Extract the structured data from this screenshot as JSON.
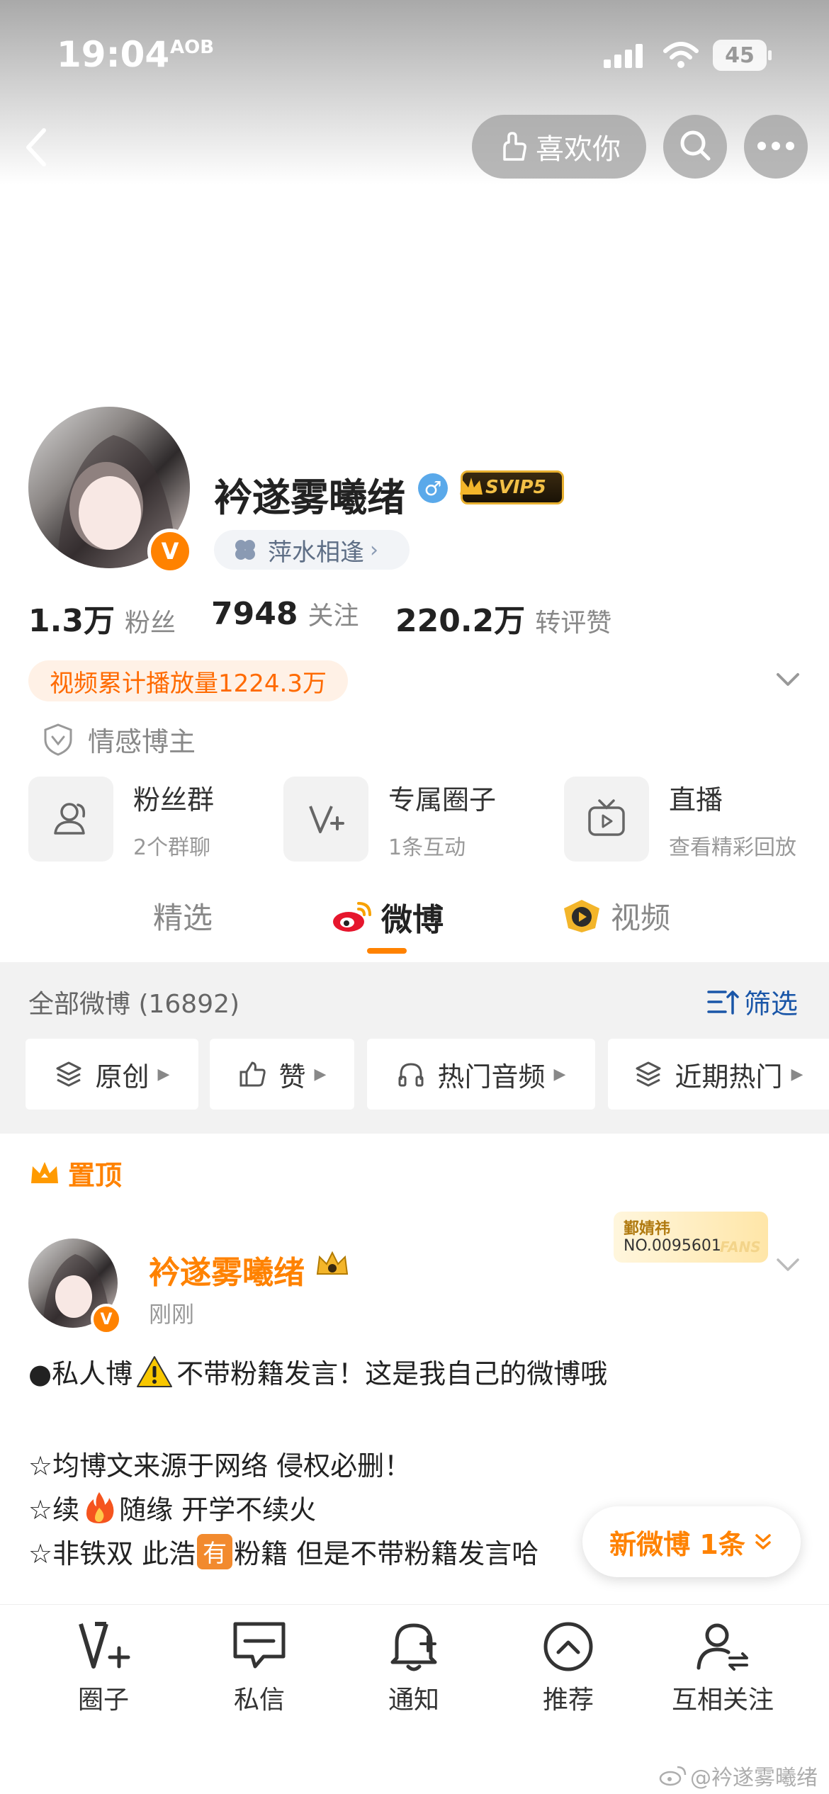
{
  "status_bar": {
    "time": "19:04",
    "app_mark": "AOB",
    "battery": "45"
  },
  "topbar": {
    "like_label": "喜欢你"
  },
  "profile": {
    "username": "衿遂雾曦绪",
    "gender_icon": "♂",
    "vip_badge": "SVIP5",
    "verified_mark": "V",
    "group_tag": "萍水相逢",
    "followers_value": "1.3万",
    "followers_label": "粉丝",
    "following_value": "7948",
    "following_label": "关注",
    "likes_value": "220.2万",
    "likes_label": "转评赞",
    "video_stat": "视频累计播放量1224.3万",
    "category": "情感博主"
  },
  "features": [
    {
      "title": "粉丝群",
      "sub": "2个群聊"
    },
    {
      "title": "专属圈子",
      "sub": "1条互动"
    },
    {
      "title": "直播",
      "sub": "查看精彩回放"
    }
  ],
  "tabs": {
    "featured": "精选",
    "weibo": "微博",
    "video": "视频"
  },
  "feed_header": {
    "all_label": "全部微博 (16892)",
    "filter_label": "筛选"
  },
  "chips": [
    "原创",
    "赞",
    "热门音频",
    "近期热门"
  ],
  "pinned": {
    "label": "置顶"
  },
  "post": {
    "author": "衿遂雾曦绪",
    "time": "刚刚",
    "fans_badge_name": "鄞婧祎",
    "fans_badge_no": "NO.0095601",
    "fans_badge_word": "FANS",
    "line1a": "●私人博",
    "line1b": "不带粉籍发言！这是我自己的微博哦",
    "line2": "☆均博文来源于网络 侵权必删！",
    "line3a": "☆续",
    "line3b": "随缘 开学不续火",
    "line4a": "☆非铁双 此浩",
    "line4mark": "有",
    "line4b": "粉籍 但是不带粉籍发言哈"
  },
  "new_posts": {
    "label": "新微博 1条"
  },
  "bottom_nav": [
    "圈子",
    "私信",
    "通知",
    "推荐",
    "互相关注"
  ],
  "watermark": "@衿遂雾曦绪",
  "colors": {
    "accent": "#ff8200",
    "blue": "#1a56a8",
    "vip_gold": "#c98a00"
  }
}
